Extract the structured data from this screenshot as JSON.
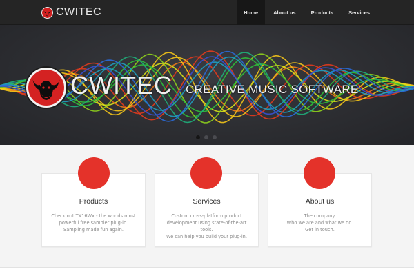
{
  "brand": {
    "name": "CWITEC",
    "logo_icon": "bull-head-icon"
  },
  "nav": {
    "items": [
      {
        "label": "Home",
        "active": true
      },
      {
        "label": "About us",
        "active": false
      },
      {
        "label": "Products",
        "active": false
      },
      {
        "label": "Services",
        "active": false
      }
    ]
  },
  "hero": {
    "title": "CWITEC",
    "subtitle": "- CREATIVE MUSIC SOFTWARE",
    "logo_icon": "bull-head-icon",
    "slides": 3,
    "active_slide": 1
  },
  "features": [
    {
      "title": "Products",
      "lines": [
        "Check out TX16Wx - the worlds most",
        "powerful free sampler plug-in.",
        "Sampling made fun again."
      ]
    },
    {
      "title": "Services",
      "lines": [
        "Custom cross-platform product",
        "development using state-of-the-art",
        "tools.",
        "We can help you build your plug-in."
      ]
    },
    {
      "title": "About us",
      "lines": [
        "The company.",
        "Who we are and what we do.",
        "Get in touch."
      ]
    }
  ],
  "colors": {
    "accent": "#e4322a",
    "navbar": "#252525",
    "hero_bg": "#2c2d31"
  }
}
